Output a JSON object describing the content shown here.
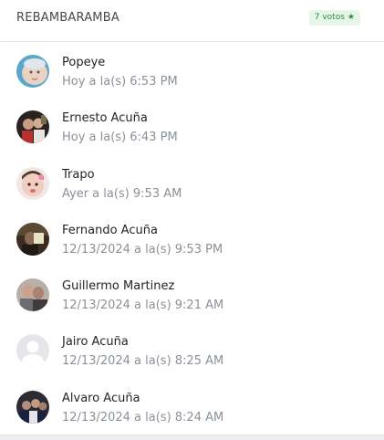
{
  "header": {
    "title": "REBAMBARAMBA",
    "votes_label": "7 votos",
    "votes_icon": "star-icon"
  },
  "voters": [
    {
      "name": "Popeye",
      "time": "Hoy a la(s) 6:53 PM"
    },
    {
      "name": "Ernesto Acuña",
      "time": "Hoy a la(s) 6:43 PM"
    },
    {
      "name": "Trapo",
      "time": "Ayer a la(s) 9:53 AM"
    },
    {
      "name": "Fernando Acuña",
      "time": "12/13/2024 a la(s) 9:53 PM"
    },
    {
      "name": "Guillermo Martinez",
      "time": "12/13/2024 a la(s) 9:21 AM"
    },
    {
      "name": "Jairo Acuña",
      "time": "12/13/2024 a la(s) 8:25 AM"
    },
    {
      "name": "Alvaro Acuña",
      "time": "12/13/2024 a la(s) 8:24 AM"
    }
  ],
  "colors": {
    "badge_bg": "#e6f6e9",
    "badge_text": "#2e8b3e",
    "secondary_text": "#8a9199"
  }
}
